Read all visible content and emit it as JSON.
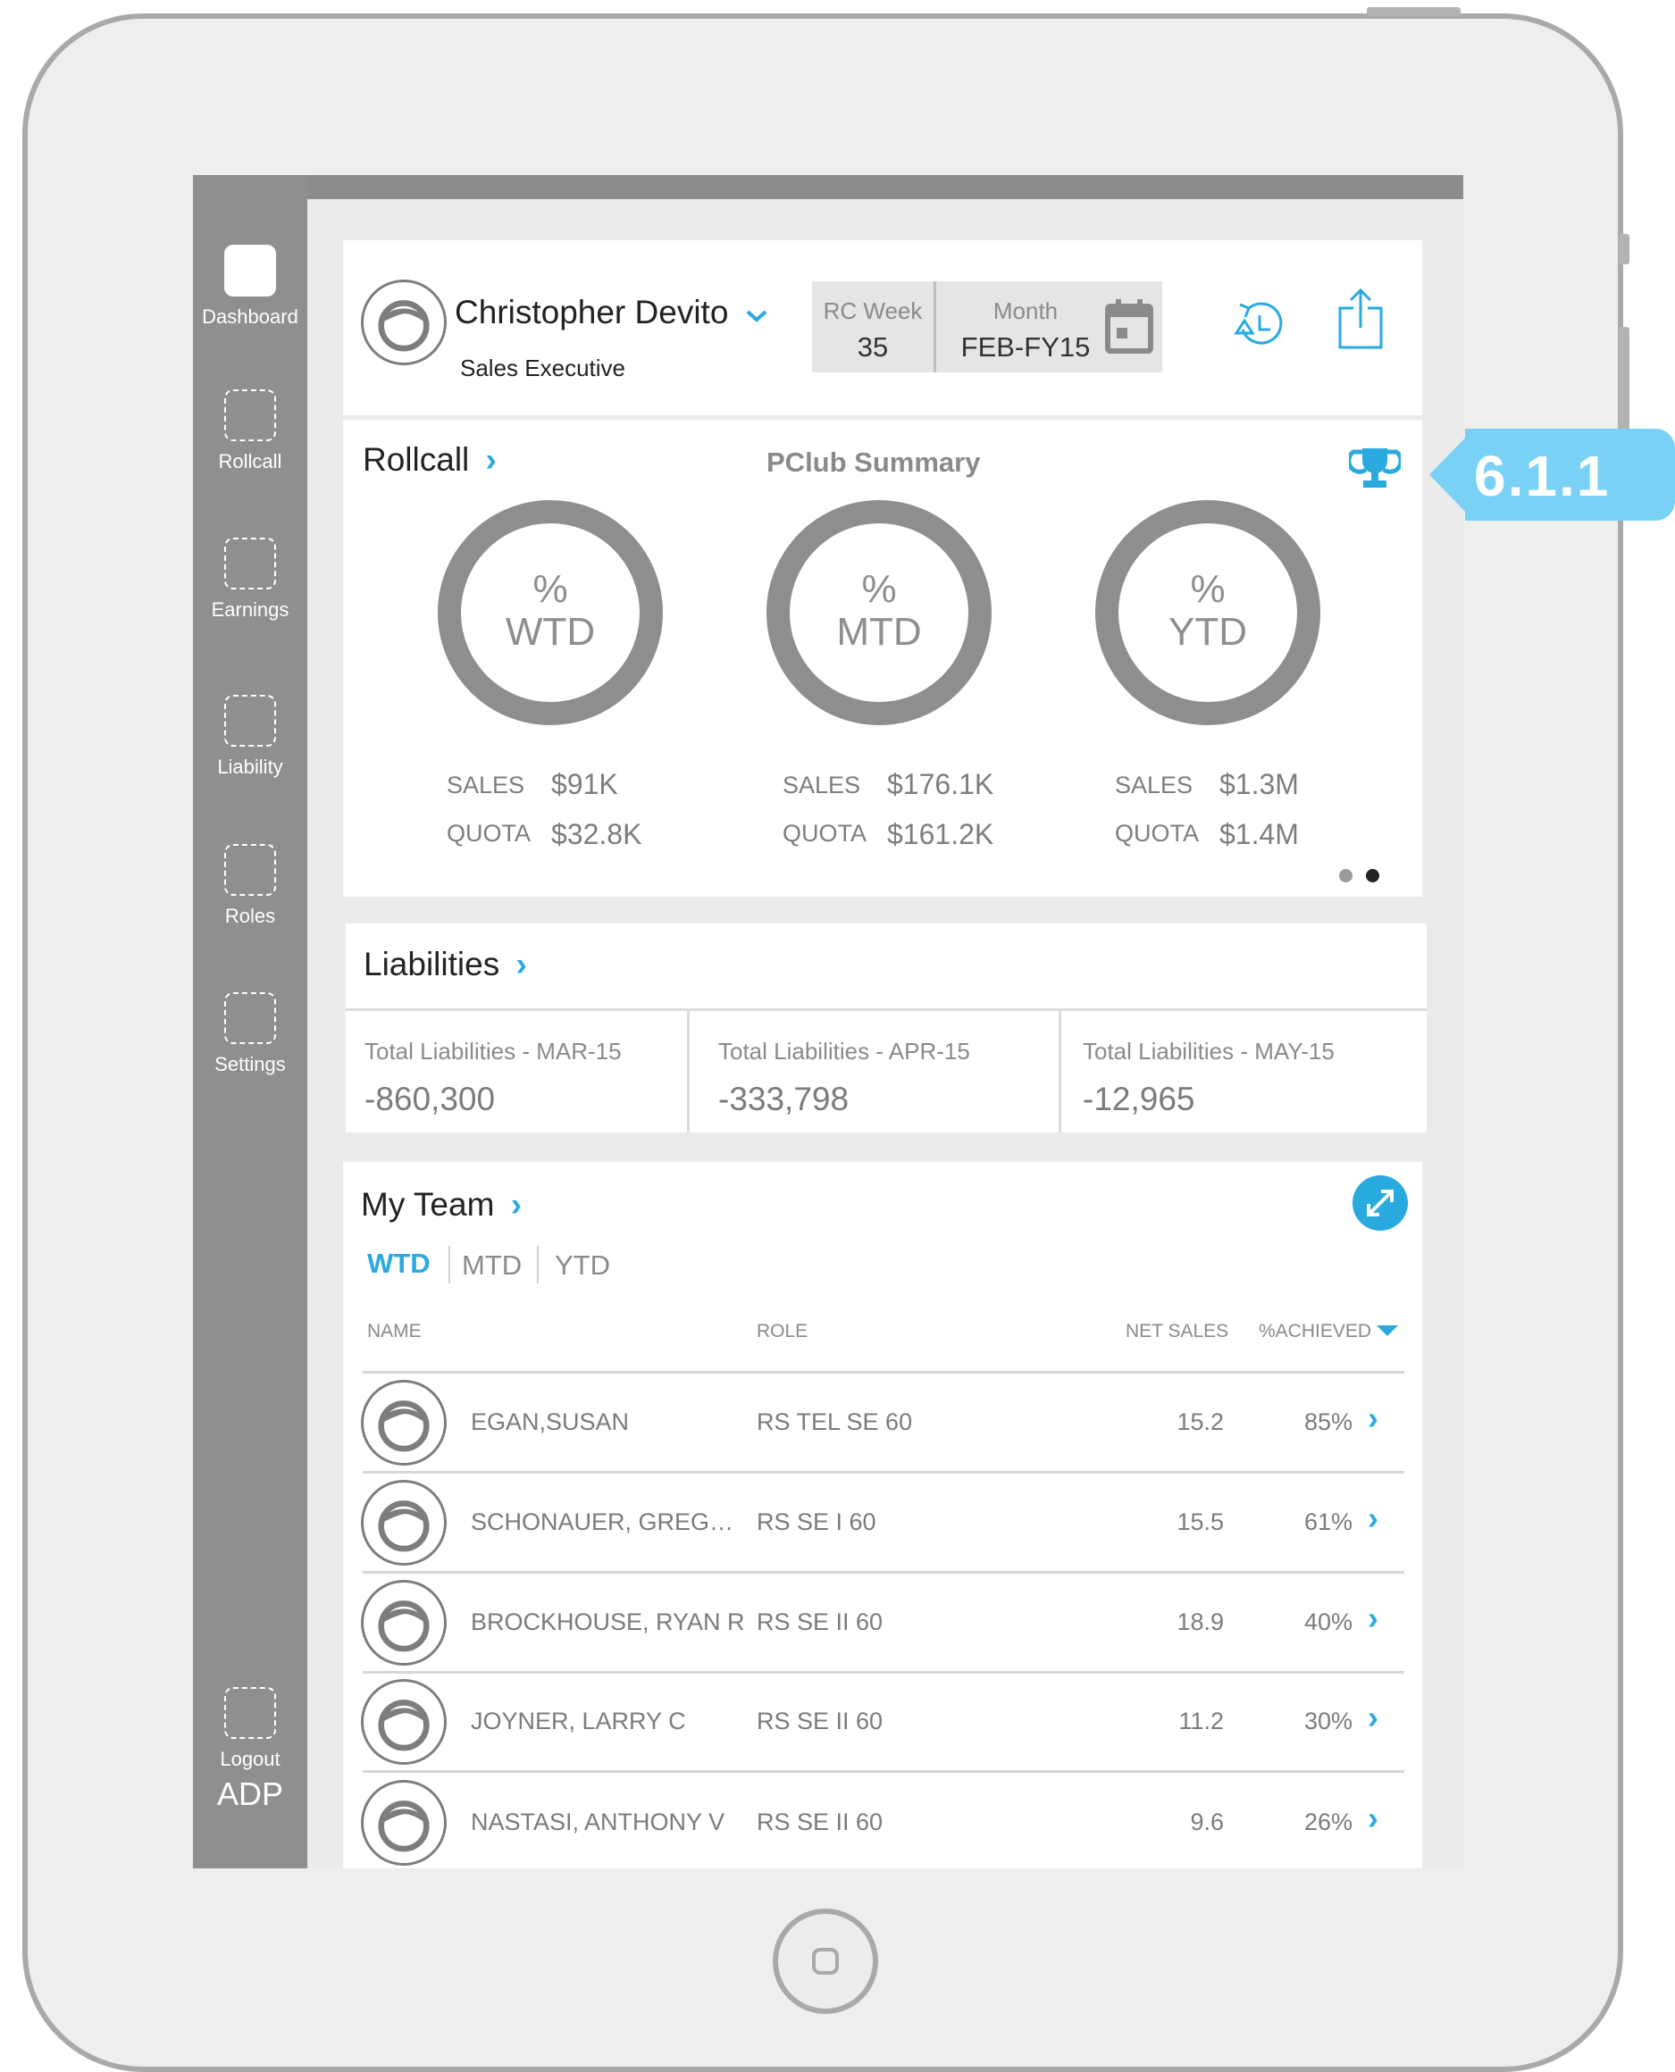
{
  "colors": {
    "accent": "#29aadf",
    "badge": "#79d1f5",
    "sidebar": "#8f8f8f",
    "ring": "#8e8e8e"
  },
  "badge": {
    "label": "6.1.1"
  },
  "sidebar": {
    "items": [
      {
        "label": "Dashboard",
        "icon": "dashboard-icon"
      },
      {
        "label": "Rollcall",
        "icon": "rollcall-icon"
      },
      {
        "label": "Earnings",
        "icon": "earnings-icon"
      },
      {
        "label": "Liability",
        "icon": "liability-icon"
      },
      {
        "label": "Roles",
        "icon": "roles-icon"
      },
      {
        "label": "Settings",
        "icon": "settings-icon"
      }
    ],
    "logout": "Logout",
    "brand": "ADP"
  },
  "header": {
    "name": "Christopher Devito",
    "role": "Sales Executive",
    "rc_week_label": "RC Week",
    "rc_week_value": "35",
    "month_label": "Month",
    "month_value": "FEB-FY15"
  },
  "rollcall": {
    "title": "Rollcall",
    "summary_title": "PClub Summary",
    "sales_label": "SALES",
    "quota_label": "QUOTA",
    "rings": [
      {
        "pct": "%",
        "period": "WTD",
        "sales": "$91K",
        "quota": "$32.8K"
      },
      {
        "pct": "%",
        "period": "MTD",
        "sales": "$176.1K",
        "quota": "$161.2K"
      },
      {
        "pct": "%",
        "period": "YTD",
        "sales": "$1.3M",
        "quota": "$1.4M"
      }
    ],
    "pager": {
      "pages": 2,
      "active": 2
    }
  },
  "liabilities": {
    "title": "Liabilities",
    "items": [
      {
        "label": "Total Liabilities - MAR-15",
        "value": "-860,300"
      },
      {
        "label": "Total Liabilities - APR-15",
        "value": "-333,798"
      },
      {
        "label": "Total Liabilities - MAY-15",
        "value": "-12,965"
      }
    ]
  },
  "team": {
    "title": "My Team",
    "tabs": [
      "WTD",
      "MTD",
      "YTD"
    ],
    "active_tab": "WTD",
    "columns": {
      "name": "NAME",
      "role": "ROLE",
      "net_sales": "NET SALES",
      "achieved": "%ACHIEVED"
    },
    "rows": [
      {
        "name": "EGAN,SUSAN",
        "role": "RS TEL SE 60",
        "net_sales": "15.2",
        "achieved": "85%"
      },
      {
        "name": "SCHONAUER, GREG…",
        "role": "RS SE I 60",
        "net_sales": "15.5",
        "achieved": "61%"
      },
      {
        "name": "BROCKHOUSE, RYAN R",
        "role": "RS SE II 60",
        "net_sales": "18.9",
        "achieved": "40%"
      },
      {
        "name": "JOYNER, LARRY C",
        "role": "RS SE II 60",
        "net_sales": "11.2",
        "achieved": "30%"
      },
      {
        "name": "NASTASI, ANTHONY V",
        "role": "RS SE II 60",
        "net_sales": "9.6",
        "achieved": "26%"
      }
    ]
  }
}
